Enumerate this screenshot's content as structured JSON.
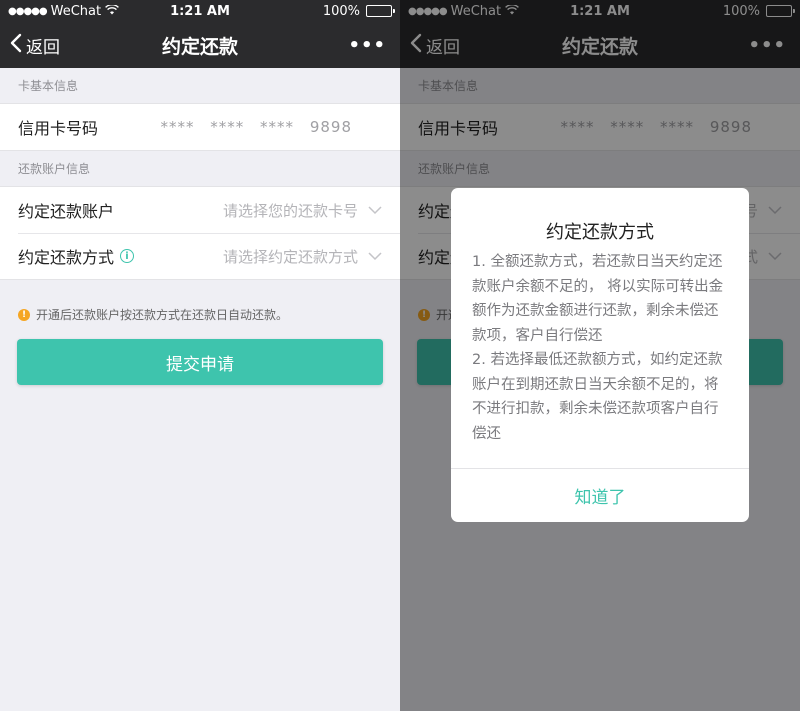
{
  "status_bar": {
    "carrier": "WeChat",
    "time": "1:21 AM",
    "battery": "100%"
  },
  "nav": {
    "back_label": "返回",
    "title": "约定还款",
    "more_label": "•••"
  },
  "card_section": {
    "header": "卡基本信息",
    "label": "信用卡号码",
    "card_number": "**** **** **** 9898"
  },
  "repay_section": {
    "header": "还款账户信息",
    "account_label": "约定还款账户",
    "account_placeholder": "请选择您的还款卡号",
    "method_label": "约定还款方式",
    "method_placeholder": "请选择约定还款方式"
  },
  "notice": "开通后还款账户按还款方式在还款日自动还款。",
  "submit_label": "提交申请",
  "dialog": {
    "title": "约定还款方式",
    "item1": "1. 全额还款方式，若还款日当天约定还款账户余额不足的， 将以实际可转出金额作为还款金额进行还款，剩余未偿还款项，客户自行偿还",
    "item2": "2. 若选择最低还款额方式，如约定还款账户在到期还款日当天余额不足的，将不进行扣款，剩余未偿还款项客户自行偿还",
    "confirm_label": "知道了"
  },
  "colors": {
    "accent": "#3ec4ad",
    "navbar": "#2b2b2d",
    "background": "#efeff4",
    "warning": "#f5a623"
  }
}
